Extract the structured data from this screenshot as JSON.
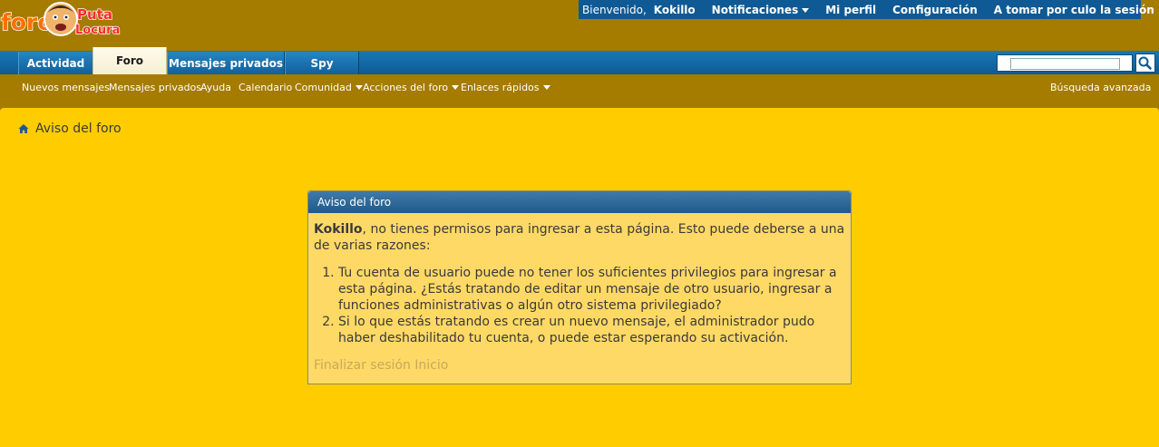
{
  "header": {
    "logo_text": "foro Puta Locura",
    "welcome_label": "Bienvenido,",
    "username": "Kokillo",
    "links": [
      {
        "label": "Notificaciones",
        "has_caret": true
      },
      {
        "label": "Mi perfil",
        "has_caret": false
      },
      {
        "label": "Configuración",
        "has_caret": false
      },
      {
        "label": "A tomar por culo la sesión",
        "has_caret": false
      }
    ]
  },
  "tabs": [
    {
      "label": "Actividad",
      "active": false
    },
    {
      "label": "Foro",
      "active": true
    },
    {
      "label": "Mensajes privados",
      "active": false
    },
    {
      "label": "Spy",
      "active": false
    }
  ],
  "search": {
    "value": "",
    "icon": "search-icon"
  },
  "subnav": {
    "items": [
      {
        "label": "Nuevos mensajes",
        "has_caret": false
      },
      {
        "label": "Mensajes privados",
        "has_caret": false
      },
      {
        "label": "Ayuda",
        "has_caret": false
      },
      {
        "label": "Calendario",
        "has_caret": false
      },
      {
        "label": "Comunidad",
        "has_caret": true
      },
      {
        "label": "Acciones del foro",
        "has_caret": true
      },
      {
        "label": "Enlaces rápidos",
        "has_caret": true
      }
    ],
    "advanced_search": "Búsqueda avanzada"
  },
  "breadcrumb": {
    "icon": "home-icon",
    "label": "Aviso del foro"
  },
  "notice": {
    "title": "Aviso del foro",
    "username": "Kokillo",
    "intro": ", no tienes permisos para ingresar a esta página. Esto puede deberse a una de varias razones:",
    "reasons": [
      "Tu cuenta de usuario puede no tener los suficientes privilegios para ingresar a esta página. ¿Estás tratando de editar un mensaje de otro usuario, ingresar a funciones administrativas o algún otro sistema privilegiado?",
      "Si lo que estás tratando es crear un nuevo mensaje, el administrador pudo haber deshabilitado tu cuenta, o puede estar esperando su activación."
    ],
    "links": [
      "Finalizar sesión",
      "Inicio"
    ]
  },
  "colors": {
    "page_bg": "#a57b00",
    "main_bg": "#ffcc00",
    "nav_blue": "#0f5a94",
    "notice_bg": "#ffd966"
  }
}
